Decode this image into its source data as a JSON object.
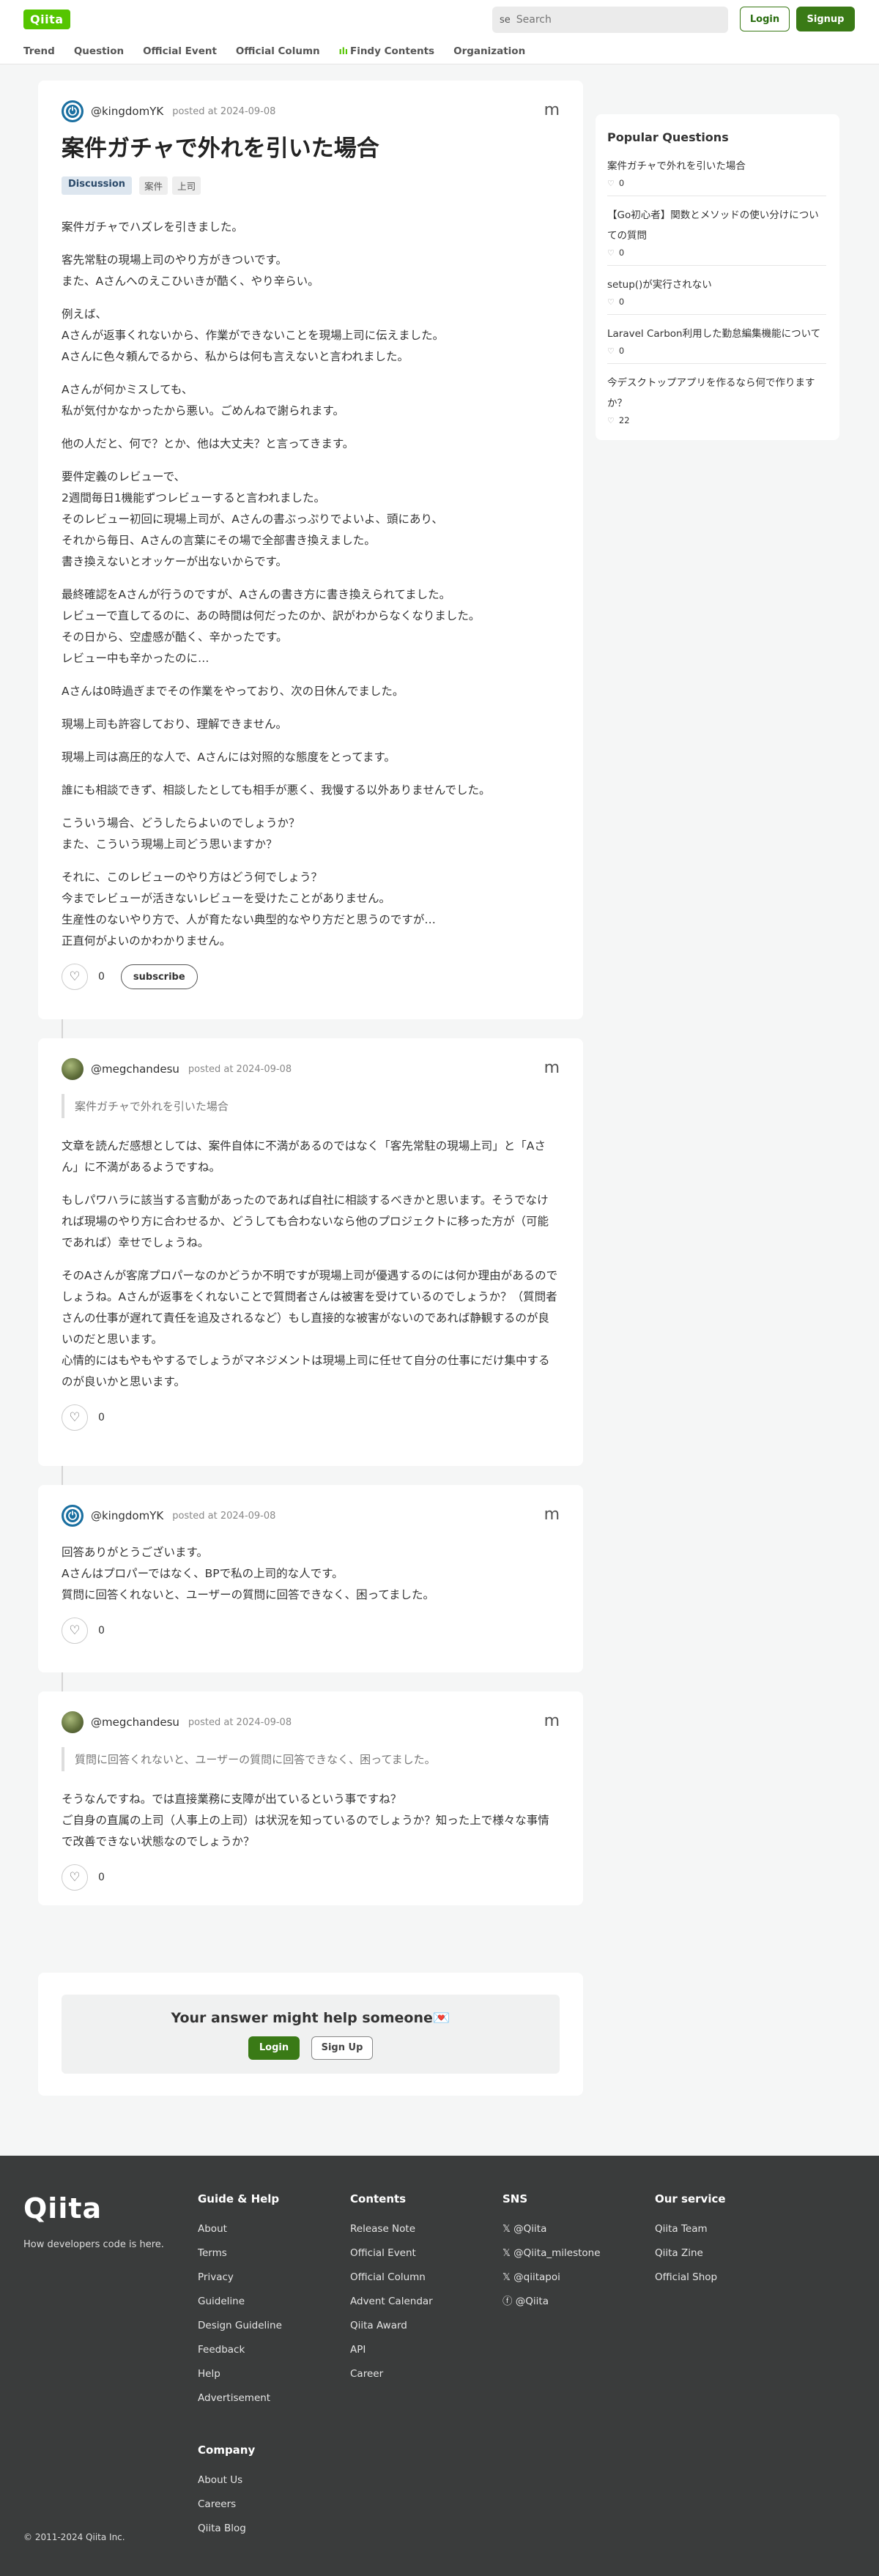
{
  "header": {
    "logo": "Qiita",
    "search_icon": "se",
    "search_placeholder": "Search",
    "login": "Login",
    "signup": "Signup",
    "nav": [
      "Trend",
      "Question",
      "Official Event",
      "Official Column",
      "Findy Contents",
      "Organization"
    ],
    "findy_icon": "ılı"
  },
  "question": {
    "username": "@kingdomYK",
    "posted": "posted at 2024-09-08",
    "menu": "m",
    "title": "案件ガチャで外れを引いた場合",
    "tag_type": "Discussion",
    "tags": [
      "案件",
      "上司"
    ],
    "paragraphs": [
      "案件ガチャでハズレを引きました。",
      "客先常駐の現場上司のやり方がきついです。\nまた、Aさんへのえこひいきが酷く、やり辛らい。",
      "例えば、\nAさんが返事くれないから、作業ができないことを現場上司に伝えました。\nAさんに色々頼んでるから、私からは何も言えないと言われました。",
      "Aさんが何かミスしても、\n私が気付かなかったから悪い。ごめんねで謝られます。",
      "他の人だと、何で？とか、他は大丈夫？と言ってきます。",
      "要件定義のレビューで、\n2週間毎日1機能ずつレビューすると言われました。\nそのレビュー初回に現場上司が、Aさんの書ぶっぷりでよいよ、頭にあり、\nそれから毎日、Aさんの言葉にその場で全部書き換えました。\n書き換えないとオッケーが出ないからです。",
      "最終確認をAさんが行うのですが、Aさんの書き方に書き換えられてました。\nレビューで直してるのに、あの時間は何だったのか、訳がわからなくなりました。\nその日から、空虚感が酷く、辛かったです。\nレビュー中も辛かったのに…",
      "Aさんは0時過ぎまでその作業をやっており、次の日休んでました。",
      "現場上司も許容しており、理解できません。",
      "現場上司は高圧的な人で、Aさんには対照的な態度をとってます。",
      "誰にも相談できず、相談したとしても相手が悪く、我慢する以外ありませんでした。",
      "こういう場合、どうしたらよいのでしょうか？\nまた、こういう現場上司どう思いますか？",
      "それに、このレビューのやり方はどう何でしょう？\n今までレビューが活きないレビューを受けたことがありません。\n生産性のないやり方で、人が育たない典型的なやり方だと思うのですが…\n正直何がよいのかわかりません。"
    ],
    "likes": "0",
    "subscribe": "subscribe"
  },
  "comments": [
    {
      "username": "@megchandesu",
      "posted": "posted at 2024-09-08",
      "menu": "m",
      "quote": "案件ガチャで外れを引いた場合",
      "paragraphs": [
        "文章を読んだ感想としては、案件自体に不満があるのではなく「客先常駐の現場上司」と「Aさん」に不満があるようですね。",
        "もしパワハラに該当する言動があったのであれば自社に相談するべきかと思います。そうでなければ現場のやり方に合わせるか、どうしても合わないなら他のプロジェクトに移った方が（可能であれば）幸せでしょうね。",
        "そのAさんが客席プロパーなのかどうか不明ですが現場上司が優遇するのには何か理由があるのでしょうね。Aさんが返事をくれないことで質問者さんは被害を受けているのでしょうか？（質問者さんの仕事が遅れて責任を追及されるなど）もし直接的な被害がないのであれば静観するのが良いのだと思います。\n心情的にはもやもやするでしょうがマネジメントは現場上司に任せて自分の仕事にだけ集中するのが良いかと思います。"
      ],
      "likes": "0"
    },
    {
      "username": "@kingdomYK",
      "posted": "posted at 2024-09-08",
      "menu": "m",
      "paragraphs": [
        "回答ありがとうございます。\nAさんはプロパーではなく、BPで私の上司的な人です。\n質問に回答くれないと、ユーザーの質問に回答できなく、困ってました。"
      ],
      "likes": "0"
    },
    {
      "username": "@megchandesu",
      "posted": "posted at 2024-09-08",
      "menu": "m",
      "quote": "質問に回答くれないと、ユーザーの質問に回答できなく、困ってました。",
      "paragraphs": [
        "そうなんですね。では直接業務に支障が出ているという事ですね？\nご自身の直属の上司（人事上の上司）は状況を知っているのでしょうか？知った上で様々な事情で改善できない状態なのでしょうか？"
      ],
      "likes": "0"
    }
  ],
  "answer_prompt": {
    "title": "Your answer might help someone💌",
    "login": "Login",
    "signup": "Sign Up"
  },
  "sidebar": {
    "title": "Popular Questions",
    "items": [
      {
        "title": "案件ガチャで外れを引いた場合",
        "likes": "0"
      },
      {
        "title": "【Go初心者】関数とメソッドの使い分けについての質問",
        "likes": "0"
      },
      {
        "title": "setup()が実行されない",
        "likes": "0"
      },
      {
        "title": "Laravel Carbon利用した勤怠編集機能について",
        "likes": "0"
      },
      {
        "title": "今デスクトップアプリを作るなら何で作りますか？",
        "likes": "22"
      }
    ]
  },
  "footer": {
    "logo": "Qiita",
    "tagline": "How developers code is here.",
    "copyright": "© 2011-2024 Qiita Inc.",
    "guide": {
      "title": "Guide & Help",
      "links": [
        "About",
        "Terms",
        "Privacy",
        "Guideline",
        "Design Guideline",
        "Feedback",
        "Help",
        "Advertisement"
      ]
    },
    "contents": {
      "title": "Contents",
      "links": [
        "Release Note",
        "Official Event",
        "Official Column",
        "Advent Calendar",
        "Qiita Award",
        "API",
        "Career"
      ]
    },
    "sns": {
      "title": "SNS",
      "links": [
        "𝕏 @Qiita",
        "𝕏 @Qiita_milestone",
        "𝕏 @qiitapoi",
        "ⓕ @Qiita"
      ]
    },
    "service": {
      "title": "Our service",
      "links": [
        "Qiita Team",
        "Qiita Zine",
        "Official Shop"
      ]
    },
    "company": {
      "title": "Company",
      "links": [
        "About Us",
        "Careers",
        "Qiita Blog"
      ]
    }
  }
}
